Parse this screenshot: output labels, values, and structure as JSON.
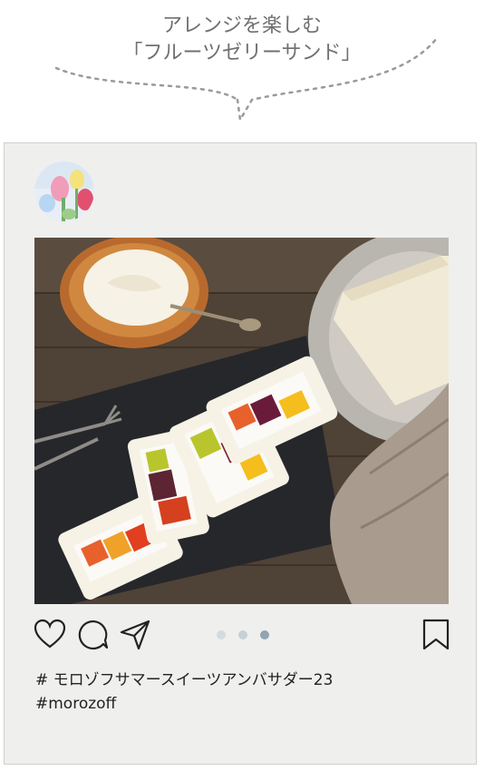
{
  "heading": {
    "line1": "アレンジを楽しむ",
    "line2": "「フルーツゼリーサンド」"
  },
  "post": {
    "avatar_label": "profile avatar",
    "photo_alt": "Fruit jelly sandwiches on a slate board with cream and bread",
    "carousel": {
      "count": 3,
      "active_index": 2
    },
    "caption_lines": [
      "# モロゾフサマースイーツアンバサダー23",
      "#morozoff"
    ]
  },
  "colors": {
    "heading": "#707070",
    "card_bg": "#efefee",
    "dot_inactive": "#d3dbe0",
    "dot_active": "#8fa5b2",
    "icon": "#222222"
  },
  "icons": [
    "heart-icon",
    "comment-icon",
    "share-icon",
    "bookmark-icon"
  ]
}
